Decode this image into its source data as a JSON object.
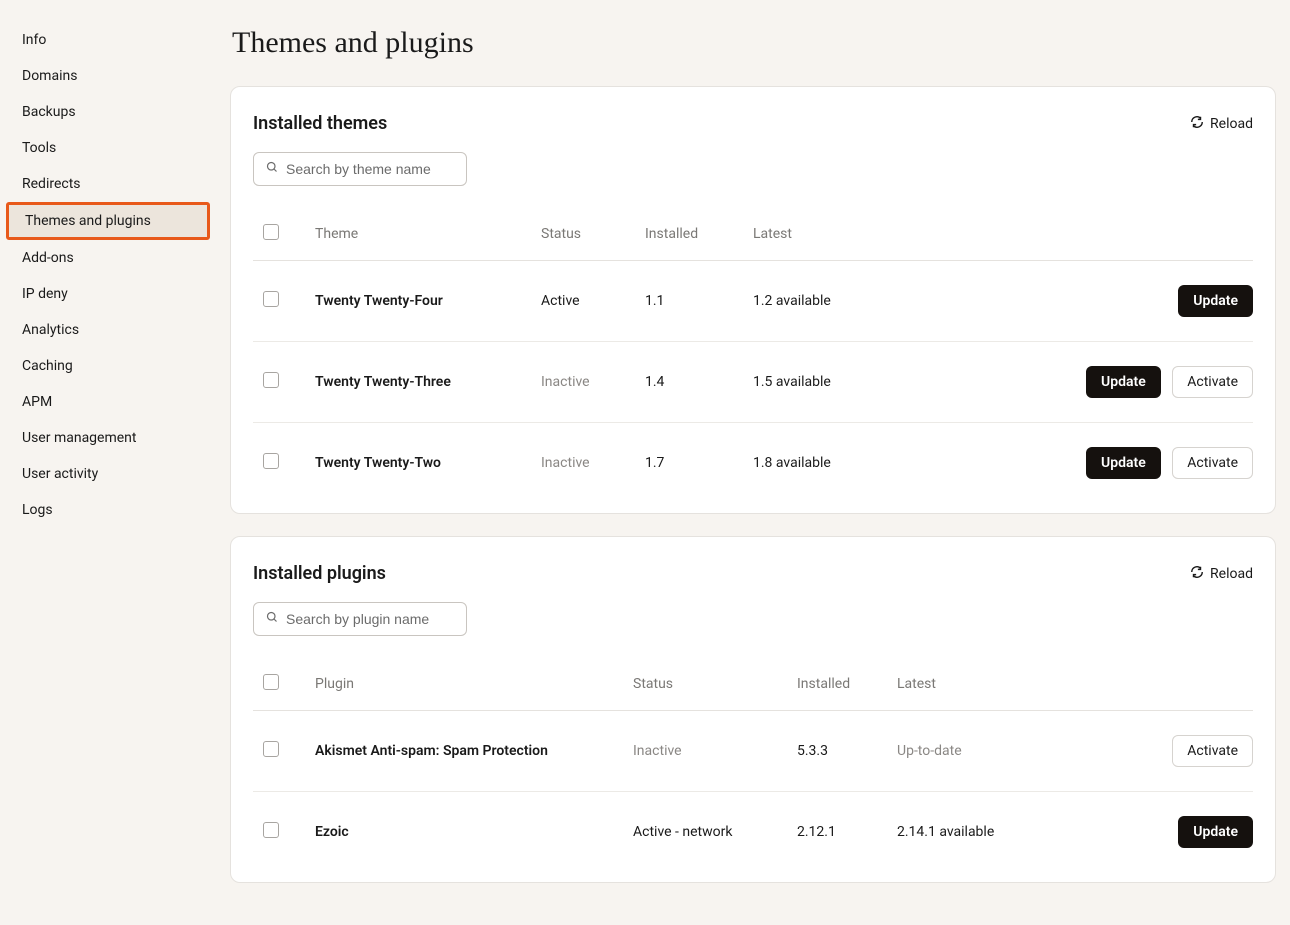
{
  "sidebar": {
    "items": [
      {
        "label": "Info",
        "active": false
      },
      {
        "label": "Domains",
        "active": false
      },
      {
        "label": "Backups",
        "active": false
      },
      {
        "label": "Tools",
        "active": false
      },
      {
        "label": "Redirects",
        "active": false
      },
      {
        "label": "Themes and plugins",
        "active": true
      },
      {
        "label": "Add-ons",
        "active": false
      },
      {
        "label": "IP deny",
        "active": false
      },
      {
        "label": "Analytics",
        "active": false
      },
      {
        "label": "Caching",
        "active": false
      },
      {
        "label": "APM",
        "active": false
      },
      {
        "label": "User management",
        "active": false
      },
      {
        "label": "User activity",
        "active": false
      },
      {
        "label": "Logs",
        "active": false
      }
    ]
  },
  "page": {
    "title": "Themes and plugins"
  },
  "themes": {
    "title": "Installed themes",
    "reload_label": "Reload",
    "search_placeholder": "Search by theme name",
    "columns": {
      "name": "Theme",
      "status": "Status",
      "installed": "Installed",
      "latest": "Latest"
    },
    "rows": [
      {
        "name": "Twenty Twenty-Four",
        "status": "Active",
        "status_class": "active",
        "installed": "1.1",
        "latest": "1.2 available",
        "update": true,
        "activate": false
      },
      {
        "name": "Twenty Twenty-Three",
        "status": "Inactive",
        "status_class": "inactive",
        "installed": "1.4",
        "latest": "1.5 available",
        "update": true,
        "activate": true
      },
      {
        "name": "Twenty Twenty-Two",
        "status": "Inactive",
        "status_class": "inactive",
        "installed": "1.7",
        "latest": "1.8 available",
        "update": true,
        "activate": true
      }
    ]
  },
  "plugins": {
    "title": "Installed plugins",
    "reload_label": "Reload",
    "search_placeholder": "Search by plugin name",
    "columns": {
      "name": "Plugin",
      "status": "Status",
      "installed": "Installed",
      "latest": "Latest"
    },
    "rows": [
      {
        "name": "Akismet Anti-spam: Spam Protection",
        "status": "Inactive",
        "status_class": "inactive",
        "installed": "5.3.3",
        "latest": "Up-to-date",
        "latest_class": "uptodate",
        "update": false,
        "activate": true
      },
      {
        "name": "Ezoic",
        "status": "Active - network",
        "status_class": "active",
        "installed": "2.12.1",
        "latest": "2.14.1 available",
        "latest_class": "",
        "update": true,
        "activate": false
      }
    ]
  },
  "buttons": {
    "update": "Update",
    "activate": "Activate"
  }
}
